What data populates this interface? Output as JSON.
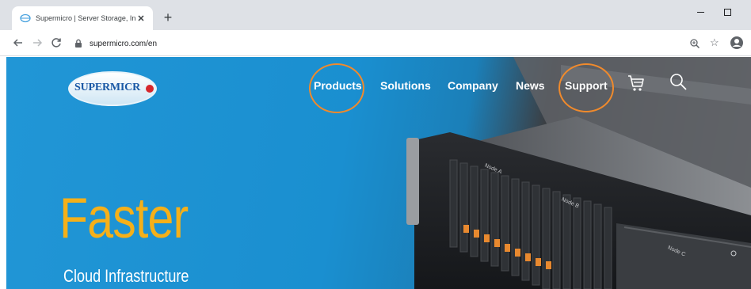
{
  "browser": {
    "tab": {
      "title": "Supermicro | Server Storage, Inno",
      "close_label": "✕"
    },
    "new_tab_label": "+",
    "address": {
      "url": "supermicro.com/en"
    },
    "icons": {
      "back": "arrow-left-icon",
      "forward": "arrow-right-icon",
      "reload": "reload-icon",
      "lock": "lock-icon",
      "zoom": "zoom-icon",
      "star": "star-icon",
      "profile": "profile-icon"
    }
  },
  "site": {
    "logo": {
      "text": "SUPERMICR"
    },
    "nav": {
      "products": "Products",
      "solutions": "Solutions",
      "company": "Company",
      "news": "News",
      "support": "Support"
    },
    "hero": {
      "headline": "Faster",
      "subline": "Cloud Infrastructure"
    },
    "server_labels": [
      "Node A",
      "Node B",
      "Node C"
    ]
  },
  "colors": {
    "hero_blue": "#1e8fd0",
    "headline_orange": "#f5b019",
    "highlight_circle": "#f08a2c",
    "logo_blue": "#1a58a5",
    "logo_red": "#d6262b"
  }
}
